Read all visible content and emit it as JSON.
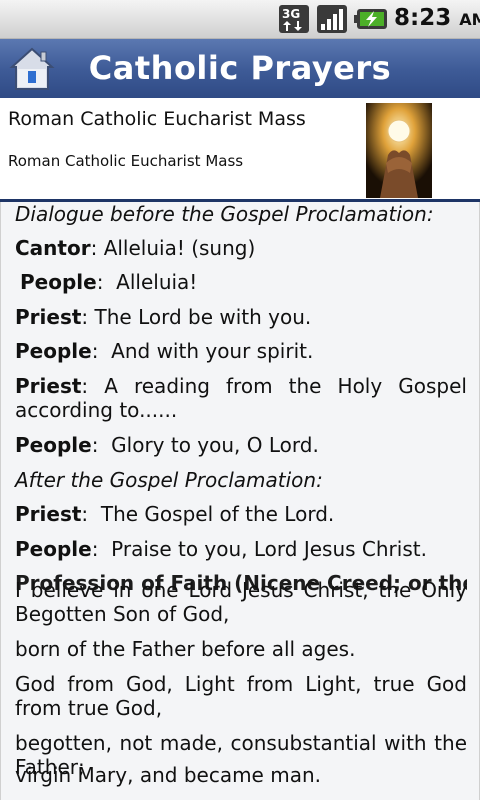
{
  "status_bar": {
    "network": "3G",
    "time": "8:23",
    "ampm": "AM"
  },
  "app": {
    "title": "Catholic Prayers"
  },
  "header": {
    "title": "Roman Catholic Eucharist Mass",
    "subtitle": "Roman Catholic Eucharist Mass"
  },
  "content": {
    "dialogue_heading": "Dialogue before the Gospel Proclamation:",
    "lines": [
      {
        "speaker": "Cantor",
        "sep": ": ",
        "text": "Alleluia! (sung)"
      },
      {
        "speaker": "People",
        "sep": ":  ",
        "text": "Alleluia!"
      },
      {
        "speaker": "Priest",
        "sep": ": ",
        "text": "The Lord be with you."
      },
      {
        "speaker": "People",
        "sep": ":  ",
        "text": "And with your spirit."
      },
      {
        "speaker": "Priest",
        "sep": ": ",
        "text": "A reading from the Holy Gospel according to......"
      },
      {
        "speaker": "People",
        "sep": ":  ",
        "text": "Glory to you, O Lord."
      }
    ],
    "after_heading": "After the Gospel Proclamation:",
    "lines2": [
      {
        "speaker": "Priest",
        "sep": ":  ",
        "text": "The Gospel of the Lord."
      },
      {
        "speaker": "People",
        "sep": ":  ",
        "text": "Praise to you, Lord Jesus Christ."
      }
    ],
    "overlap_heading": "Profession of Faith (Nicene Creed; or the",
    "creed": [
      "I believe in one Lord Jesus Christ, the Only Begotten Son of God,",
      "born of the Father before all ages.",
      "God from God, Light from Light, true God from true God,",
      "begotten, not made, consubstantial with the Father;",
      "virgin Mary, and became man."
    ]
  }
}
